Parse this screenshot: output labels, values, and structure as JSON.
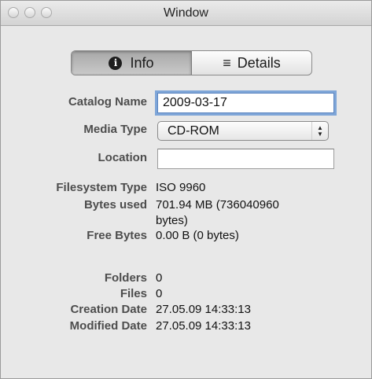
{
  "window": {
    "title": "Window"
  },
  "segmented": {
    "info_label": "Info",
    "details_label": "Details",
    "info_icon": "i",
    "details_icon": "≡",
    "selected": "Info"
  },
  "form": {
    "catalog_name": {
      "label": "Catalog Name",
      "value": "2009-03-17"
    },
    "media_type": {
      "label": "Media Type",
      "value": "CD-ROM"
    },
    "location": {
      "label": "Location",
      "value": ""
    }
  },
  "info": {
    "filesystem_type": {
      "label": "Filesystem Type",
      "value": "ISO 9960"
    },
    "bytes_used": {
      "label": "Bytes used",
      "value_line1": "701.94 MB (736040960",
      "value_line2": "bytes)"
    },
    "free_bytes": {
      "label": "Free Bytes",
      "value": "0.00 B (0 bytes)"
    },
    "folders": {
      "label": "Folders",
      "value": "0"
    },
    "files": {
      "label": "Files",
      "value": "0"
    },
    "creation_date": {
      "label": "Creation Date",
      "value": "27.05.09 14:33:13"
    },
    "modified_date": {
      "label": "Modified Date",
      "value": "27.05.09 14:33:13"
    }
  },
  "icons": {
    "close": "close-icon",
    "minimize": "minimize-icon",
    "zoom": "zoom-icon",
    "info": "info-icon",
    "details": "list-icon",
    "popup": "updown-arrows-icon"
  }
}
